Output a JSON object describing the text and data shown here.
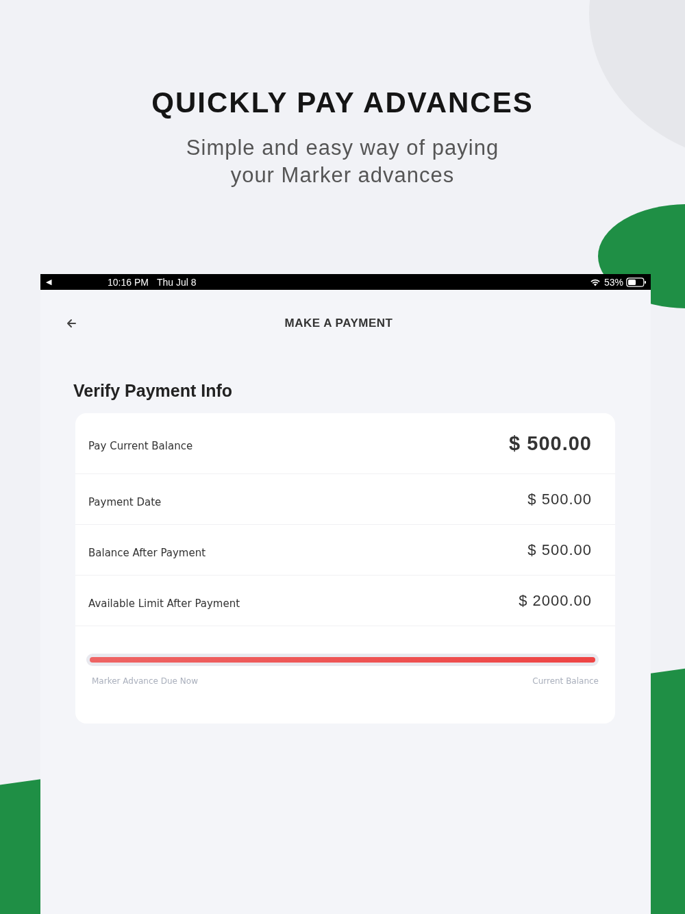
{
  "headline": "QUICKLY PAY ADVANCES",
  "subtitle": [
    "Simple and easy way of paying",
    "your Marker advances"
  ],
  "status_bar": {
    "back_glyph": "◀",
    "time": "10:16 PM",
    "date": "Thu Jul 8",
    "battery": "53%"
  },
  "nav": {
    "title": "MAKE A PAYMENT"
  },
  "section_title": "Verify Payment Info",
  "rows": [
    {
      "label": "Pay Current Balance",
      "value": "$ 500.00",
      "kind": "large"
    },
    {
      "label": "Payment Date",
      "value": "$ 500.00",
      "kind": "normal"
    },
    {
      "label": "Balance After Payment",
      "value": "$ 500.00",
      "kind": "normal"
    },
    {
      "label": "Available Limit After Payment",
      "value": "$ 2000.00",
      "kind": "normal"
    }
  ],
  "progress": {
    "level": 1.0,
    "left_label": "Marker Advance Due Now",
    "right_label": "Current Balance"
  }
}
